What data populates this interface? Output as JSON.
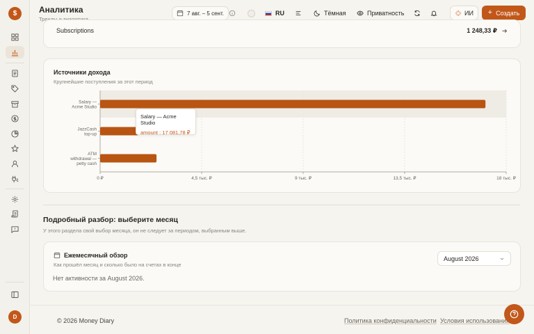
{
  "app": {
    "logo": "$",
    "title": "Аналитика",
    "subtitle": "Тренды и аналитика",
    "avatar": "D"
  },
  "header": {
    "date_range": "7 авг. – 5 сент.",
    "language": "RU",
    "theme_label": "Тёмная",
    "privacy_label": "Приватность",
    "ai_label": "ИИ",
    "create_label": "Создать"
  },
  "subscriptions": {
    "label": "Subscriptions",
    "amount": "1 248,33 ₽"
  },
  "income_sources": {
    "title": "Источники дохода",
    "subtitle": "Крупнейшие поступления за этот период",
    "tooltip": {
      "title": "Salary — Acme Studio",
      "value": "amount : 17 081,78 ₽"
    }
  },
  "chart_data": {
    "type": "bar",
    "orientation": "horizontal",
    "categories": [
      [
        "Salary —",
        "Acme Studio"
      ],
      [
        "JazzCash",
        "top-up"
      ],
      [
        "ATM",
        "withdrawal —",
        "petty cash"
      ]
    ],
    "values": [
      17081.78,
      1700,
      2500
    ],
    "xlim": [
      0,
      18000
    ],
    "xticks": [
      0,
      4500,
      9000,
      13500,
      18000
    ],
    "xtick_labels": [
      "0 ₽",
      "4,5 тыс. ₽",
      "9 тыс. ₽",
      "13,5 тыс. ₽",
      "18 тыс. ₽"
    ],
    "bar_color": "#b85512",
    "highlight_index": 0,
    "grid": true
  },
  "detail": {
    "title": "Подробный разбор: выберите месяц",
    "subtitle": "У этого раздела свой выбор месяца, он не следует за периодом, выбранным выше.",
    "card_title": "Ежемесячный обзор",
    "card_subtitle": "Как прошёл месяц и сколько было на счетах в конце",
    "month_selected": "August 2026",
    "empty_message": "Нет активности за August 2026."
  },
  "footer": {
    "copyright": "© 2026 Money Diary",
    "privacy_link": "Политика конфиденциальности",
    "terms_link": "Условия использования"
  },
  "colors": {
    "accent": "#c2571a",
    "bar": "#b85512"
  }
}
